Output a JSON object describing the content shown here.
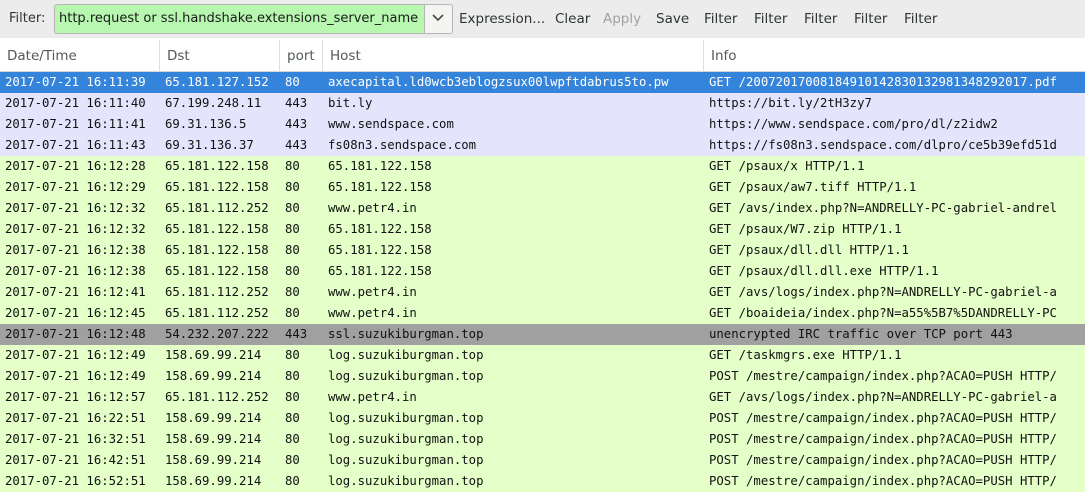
{
  "toolbar": {
    "filter_label": "Filter:",
    "filter_value": "http.request or ssl.handshake.extensions_server_name",
    "buttons": [
      "Expression...",
      "Clear",
      "Apply",
      "Save",
      "Filter",
      "Filter",
      "Filter",
      "Filter",
      "Filter"
    ]
  },
  "columns": [
    "Date/Time",
    "Dst",
    "port",
    "Host",
    "Info"
  ],
  "rows": [
    {
      "datetime": "2017-07-21 16:11:39",
      "dst": "65.181.127.152",
      "port": "80",
      "host": "axecapital.ld0wcb3eblogzsux00lwpftdabrus5to.pw",
      "info": "GET /20072017008184910142830132981348292017.pdf",
      "type": "selected"
    },
    {
      "datetime": "2017-07-21 16:11:40",
      "dst": "67.199.248.11",
      "port": "443",
      "host": "bit.ly",
      "info": "https://bit.ly/2tH3zy7",
      "type": "tls"
    },
    {
      "datetime": "2017-07-21 16:11:41",
      "dst": "69.31.136.5",
      "port": "443",
      "host": "www.sendspace.com",
      "info": "https://www.sendspace.com/pro/dl/z2idw2",
      "type": "tls"
    },
    {
      "datetime": "2017-07-21 16:11:43",
      "dst": "69.31.136.37",
      "port": "443",
      "host": "fs08n3.sendspace.com",
      "info": "https://fs08n3.sendspace.com/dlpro/ce5b39efd51d",
      "type": "tls"
    },
    {
      "datetime": "2017-07-21 16:12:28",
      "dst": "65.181.122.158",
      "port": "80",
      "host": "65.181.122.158",
      "info": "GET /psaux/x HTTP/1.1",
      "type": "http"
    },
    {
      "datetime": "2017-07-21 16:12:29",
      "dst": "65.181.122.158",
      "port": "80",
      "host": "65.181.122.158",
      "info": "GET /psaux/aw7.tiff HTTP/1.1",
      "type": "http"
    },
    {
      "datetime": "2017-07-21 16:12:32",
      "dst": "65.181.112.252",
      "port": "80",
      "host": "www.petr4.in",
      "info": "GET /avs/index.php?N=ANDRELLY-PC-gabriel-andrel",
      "type": "http"
    },
    {
      "datetime": "2017-07-21 16:12:32",
      "dst": "65.181.122.158",
      "port": "80",
      "host": "65.181.122.158",
      "info": "GET /psaux/W7.zip HTTP/1.1",
      "type": "http"
    },
    {
      "datetime": "2017-07-21 16:12:38",
      "dst": "65.181.122.158",
      "port": "80",
      "host": "65.181.122.158",
      "info": "GET /psaux/dll.dll HTTP/1.1",
      "type": "http"
    },
    {
      "datetime": "2017-07-21 16:12:38",
      "dst": "65.181.122.158",
      "port": "80",
      "host": "65.181.122.158",
      "info": "GET /psaux/dll.dll.exe HTTP/1.1",
      "type": "http"
    },
    {
      "datetime": "2017-07-21 16:12:41",
      "dst": "65.181.112.252",
      "port": "80",
      "host": "www.petr4.in",
      "info": "GET /avs/logs/index.php?N=ANDRELLY-PC-gabriel-a",
      "type": "http"
    },
    {
      "datetime": "2017-07-21 16:12:45",
      "dst": "65.181.112.252",
      "port": "80",
      "host": "www.petr4.in",
      "info": "GET /boaideia/index.php?N=a55%5B7%5DANDRELLY-PC",
      "type": "http"
    },
    {
      "datetime": "2017-07-21 16:12:48",
      "dst": "54.232.207.222",
      "port": "443",
      "host": "ssl.suzukiburgman.top",
      "info": "unencrypted IRC traffic over TCP port 443",
      "type": "irc"
    },
    {
      "datetime": "2017-07-21 16:12:49",
      "dst": "158.69.99.214",
      "port": "80",
      "host": "log.suzukiburgman.top",
      "info": "GET /taskmgrs.exe HTTP/1.1",
      "type": "http"
    },
    {
      "datetime": "2017-07-21 16:12:49",
      "dst": "158.69.99.214",
      "port": "80",
      "host": "log.suzukiburgman.top",
      "info": "POST /mestre/campaign/index.php?ACAO=PUSH HTTP/",
      "type": "http"
    },
    {
      "datetime": "2017-07-21 16:12:57",
      "dst": "65.181.112.252",
      "port": "80",
      "host": "www.petr4.in",
      "info": "GET /avs/logs/index.php?N=ANDRELLY-PC-gabriel-a",
      "type": "http"
    },
    {
      "datetime": "2017-07-21 16:22:51",
      "dst": "158.69.99.214",
      "port": "80",
      "host": "log.suzukiburgman.top",
      "info": "POST /mestre/campaign/index.php?ACAO=PUSH HTTP/",
      "type": "http"
    },
    {
      "datetime": "2017-07-21 16:32:51",
      "dst": "158.69.99.214",
      "port": "80",
      "host": "log.suzukiburgman.top",
      "info": "POST /mestre/campaign/index.php?ACAO=PUSH HTTP/",
      "type": "http"
    },
    {
      "datetime": "2017-07-21 16:42:51",
      "dst": "158.69.99.214",
      "port": "80",
      "host": "log.suzukiburgman.top",
      "info": "POST /mestre/campaign/index.php?ACAO=PUSH HTTP/",
      "type": "http"
    },
    {
      "datetime": "2017-07-21 16:52:51",
      "dst": "158.69.99.214",
      "port": "80",
      "host": "log.suzukiburgman.top",
      "info": "POST /mestre/campaign/index.php?ACAO=PUSH HTTP/",
      "type": "http"
    }
  ],
  "colors": {
    "selected": "#3584dc",
    "tls": "#e4e4fc",
    "http": "#e4ffc8",
    "irc": "#a0a0a0",
    "filter_valid": "#b7f7b0"
  }
}
